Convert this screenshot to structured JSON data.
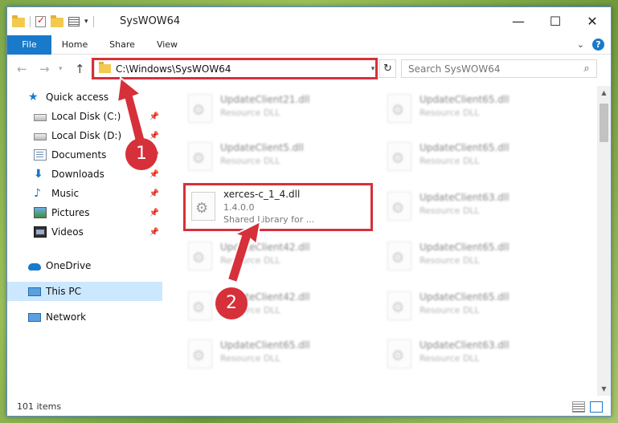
{
  "window": {
    "title": "SysWOW64",
    "minimize": "—",
    "maximize": "☐",
    "close": "✕"
  },
  "ribbon": {
    "tabs": [
      "File",
      "Home",
      "Share",
      "View"
    ],
    "help": "?"
  },
  "address": {
    "path": "C:\\Windows\\SysWOW64"
  },
  "search": {
    "placeholder": "Search SysWOW64"
  },
  "sidebar": {
    "items": [
      {
        "label": "Quick access",
        "icon": "star-icon"
      },
      {
        "label": "Local Disk (C:)",
        "icon": "drive-icon",
        "pinned": true
      },
      {
        "label": "Local Disk (D:)",
        "icon": "drive-icon",
        "pinned": true
      },
      {
        "label": "Documents",
        "icon": "documents-icon",
        "pinned": true
      },
      {
        "label": "Downloads",
        "icon": "downloads-icon",
        "pinned": true
      },
      {
        "label": "Music",
        "icon": "music-icon",
        "pinned": true
      },
      {
        "label": "Pictures",
        "icon": "pictures-icon",
        "pinned": true
      },
      {
        "label": "Videos",
        "icon": "videos-icon",
        "pinned": true
      },
      {
        "label": "OneDrive",
        "icon": "onedrive-icon"
      },
      {
        "label": "This PC",
        "icon": "this-pc-icon",
        "selected": true
      },
      {
        "label": "Network",
        "icon": "network-icon"
      }
    ]
  },
  "files": {
    "left": [
      {
        "name": "UpdateClient21.dll",
        "sub": "Resource DLL"
      },
      {
        "name": "UpdateClient5.dll",
        "sub": "Resource DLL"
      },
      {
        "name": "xerces-c_1_4.dll",
        "version": "1.4.0.0",
        "sub": "Shared Library for ..."
      },
      {
        "name": "UpdateClient42.dll",
        "sub": "Resource DLL"
      },
      {
        "name": "UpdateClient42.dll",
        "sub": "Resource DLL"
      },
      {
        "name": "UpdateClient65.dll",
        "sub": "Resource DLL"
      }
    ],
    "right": [
      {
        "name": "UpdateClient65.dll",
        "sub": "Resource DLL"
      },
      {
        "name": "UpdateClient65.dll",
        "sub": "Resource DLL"
      },
      {
        "name": "UpdateClient63.dll",
        "sub": "Resource DLL"
      },
      {
        "name": "UpdateClient65.dll",
        "sub": "Resource DLL"
      },
      {
        "name": "UpdateClient65.dll",
        "sub": "Resource DLL"
      },
      {
        "name": "UpdateClient63.dll",
        "sub": "Resource DLL"
      }
    ]
  },
  "status": {
    "count": "101 items"
  },
  "annotations": {
    "step1": "1",
    "step2": "2",
    "color": "#d6303a"
  }
}
